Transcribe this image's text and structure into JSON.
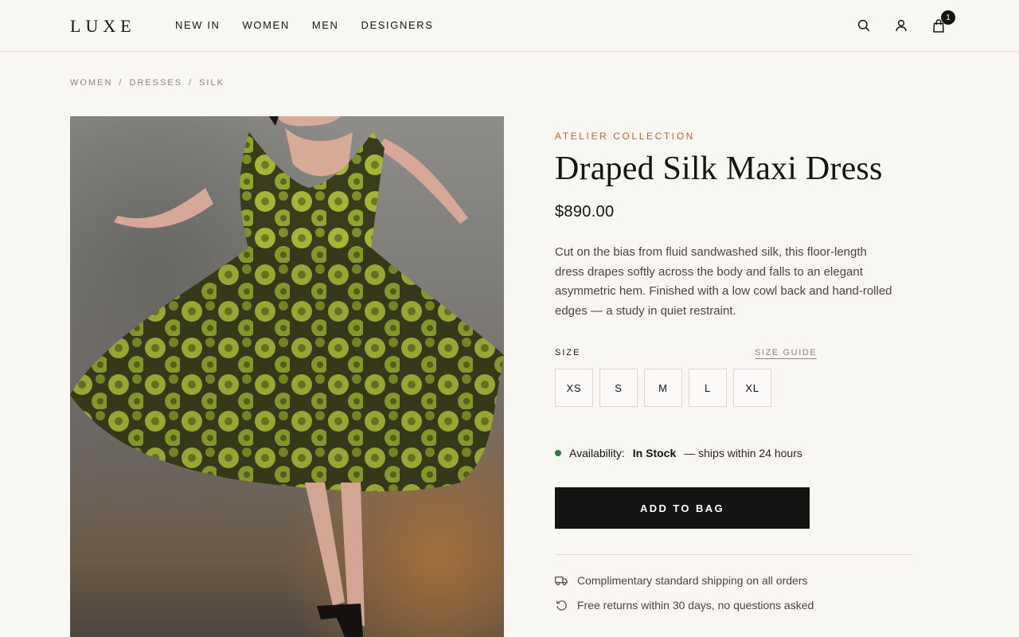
{
  "header": {
    "logo": "LUXE",
    "nav": [
      "NEW IN",
      "WOMEN",
      "MEN",
      "DESIGNERS"
    ],
    "cart_count": "1",
    "icons": [
      "search-icon",
      "user-icon",
      "bag-icon"
    ]
  },
  "breadcrumb": [
    "WOMEN",
    "/",
    "DRESSES",
    "/",
    "SILK"
  ],
  "product": {
    "collection": "ATELIER COLLECTION",
    "title": "Draped Silk Maxi Dress",
    "price": "$890.00",
    "description": "Cut on the bias from fluid sandwashed silk, this floor-length dress drapes softly across the body and falls to an elegant asymmetric hem. Finished with a low cowl back and hand-rolled edges — a study in quiet restraint.",
    "size_label": "SIZE",
    "size_guide": "SIZE GUIDE",
    "sizes": [
      "XS",
      "S",
      "M",
      "L",
      "XL"
    ],
    "availability_label": "Availability:",
    "availability_status": "In Stock",
    "availability_note": "— ships within 24 hours",
    "add_to_bag": "ADD TO BAG",
    "perks": [
      {
        "icon": "truck-icon",
        "text": "Complimentary standard shipping on all orders"
      },
      {
        "icon": "return-icon",
        "text": "Free returns within 30 days, no questions asked"
      }
    ]
  },
  "colors": {
    "background": "#f8f7f4",
    "accent": "#b0683a",
    "button": "#161412",
    "in_stock": "#2f7a3c"
  }
}
